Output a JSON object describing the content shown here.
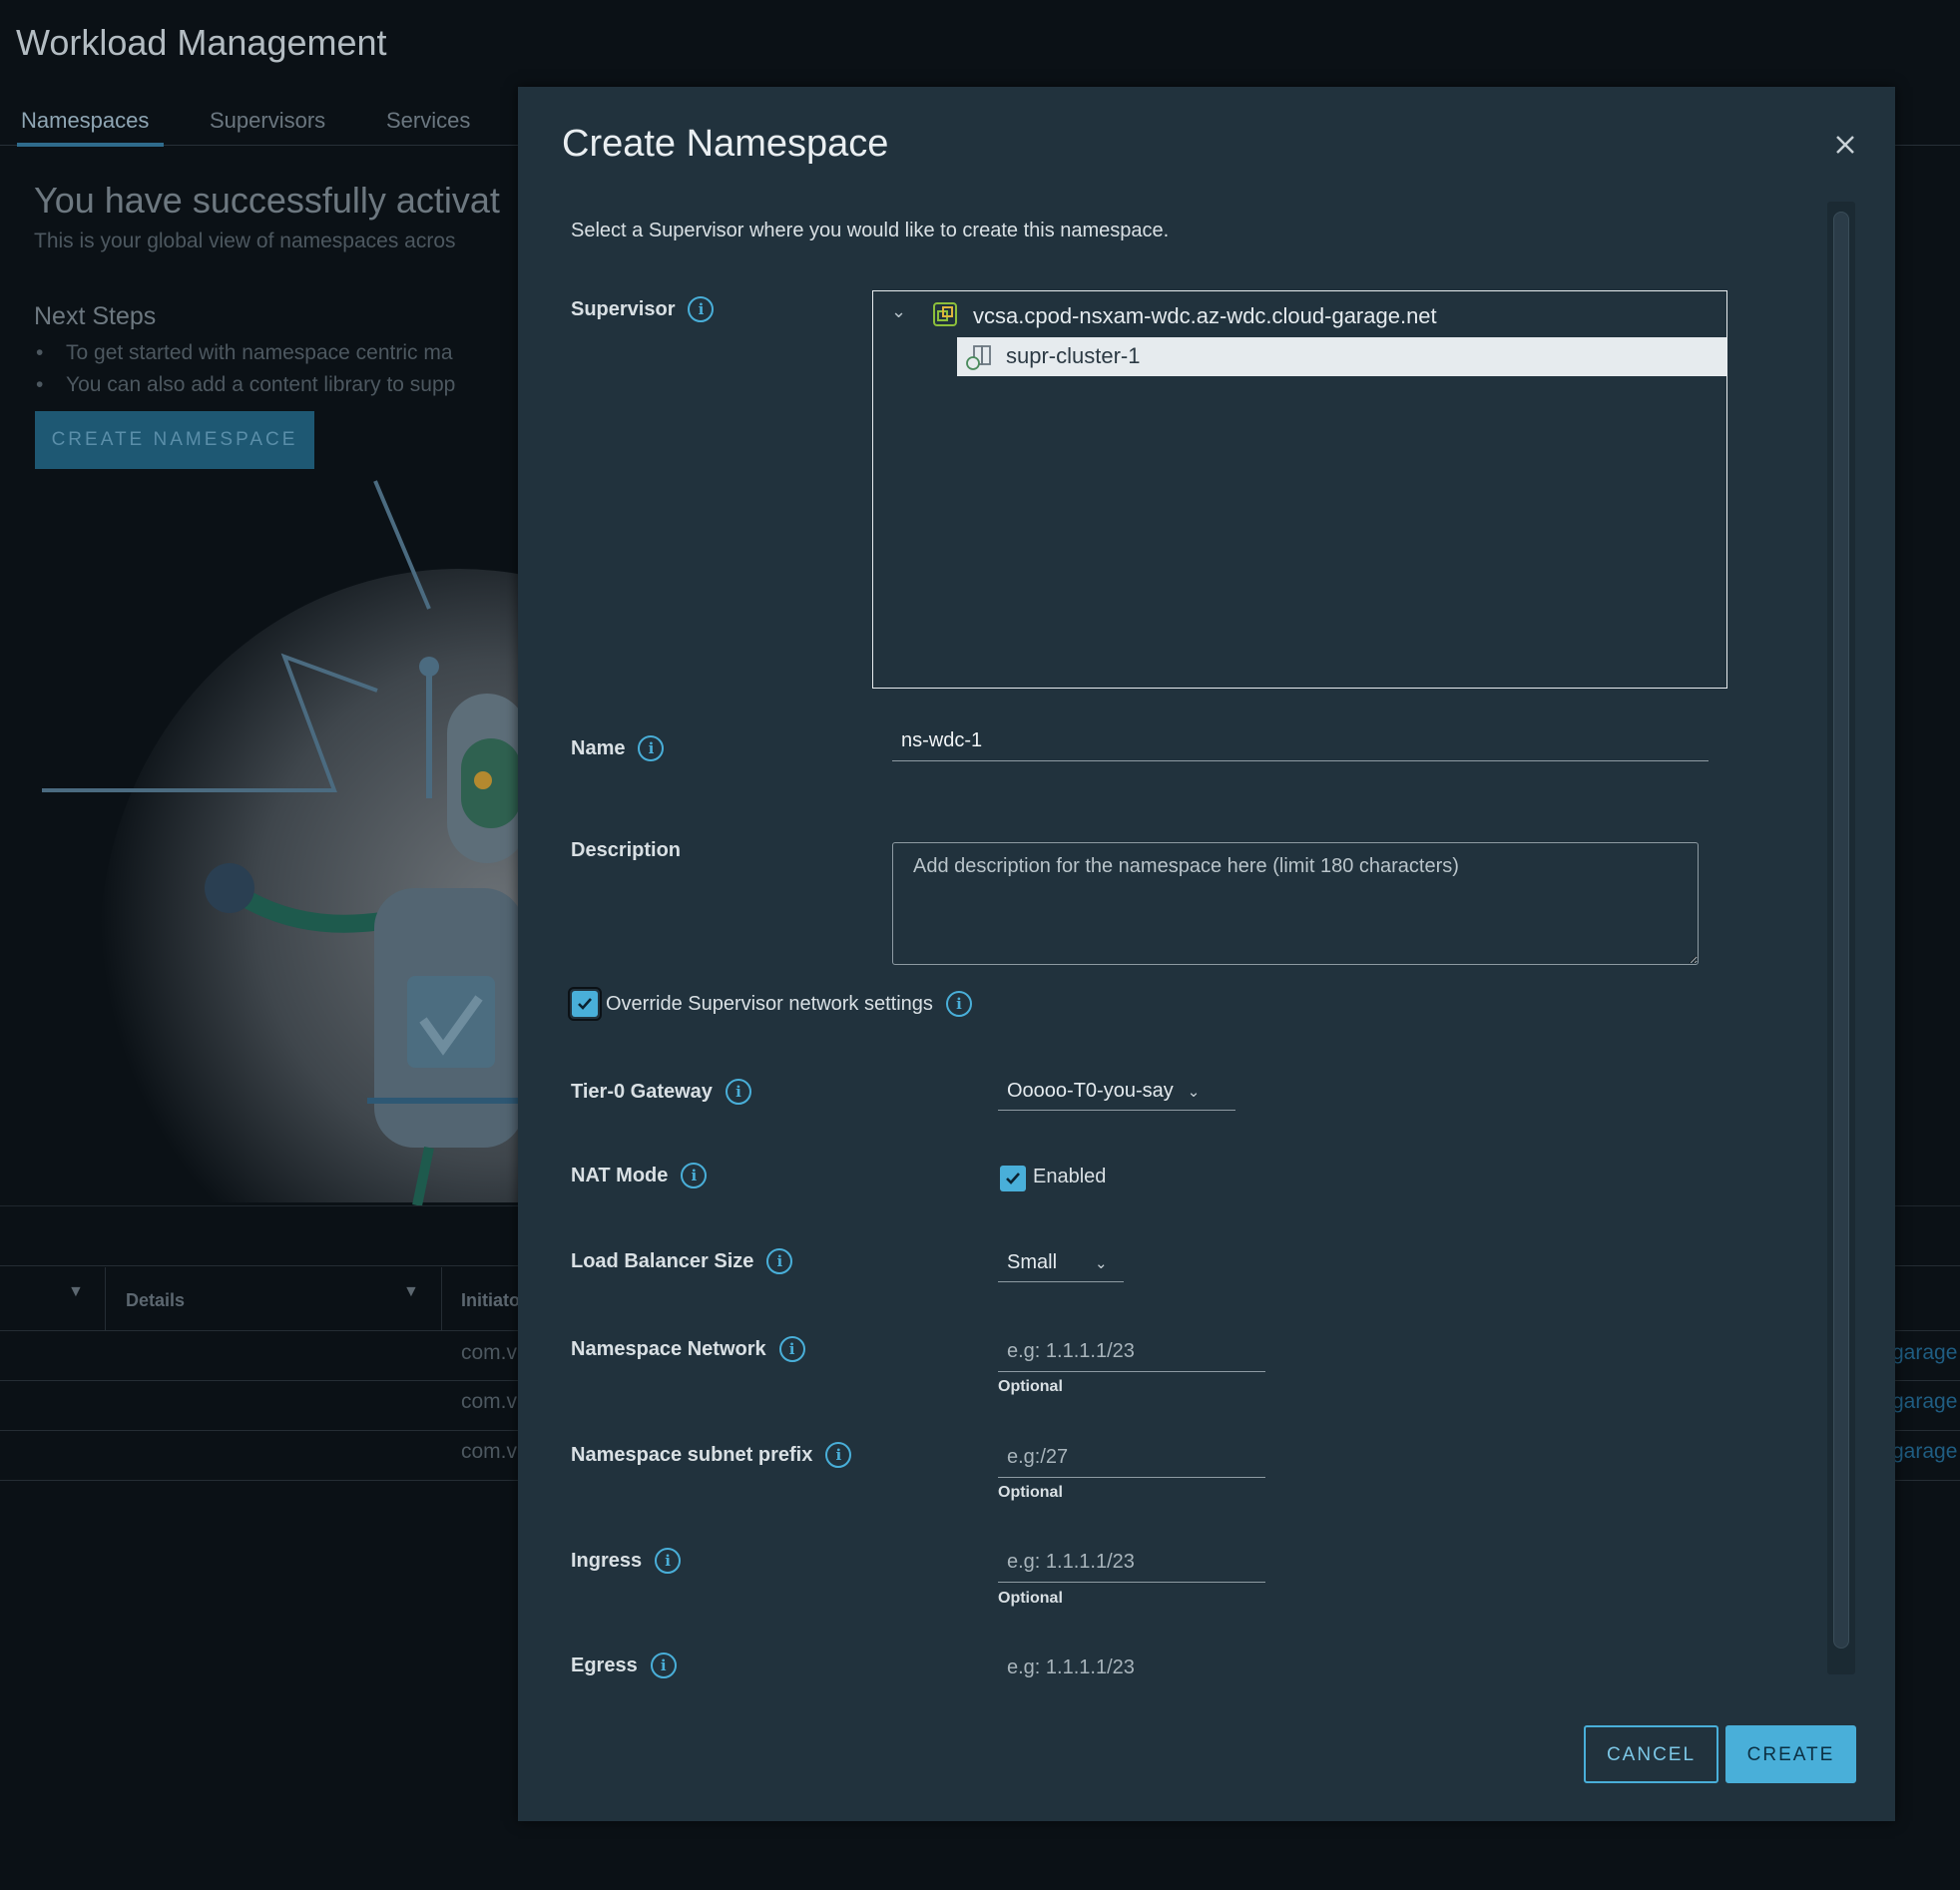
{
  "app": {
    "title": "Workload Management",
    "tabs": [
      "Namespaces",
      "Supervisors",
      "Services"
    ],
    "hero_title": "You have successfully activat",
    "hero_subtitle": "This is your global view of namespaces acros",
    "next_steps_title": "Next Steps",
    "next_steps": [
      "To get started with namespace centric ma",
      "You can also add a content library to supp"
    ],
    "create_namespace_button": "CREATE NAMESPACE",
    "grid": {
      "columns": [
        "Details",
        "Initiato"
      ],
      "rows": [
        {
          "initiator": "com.v",
          "link": "garage"
        },
        {
          "initiator": "com.v",
          "link": "garage"
        },
        {
          "initiator": "com.v",
          "link": "garage"
        }
      ]
    }
  },
  "modal": {
    "title": "Create Namespace",
    "intro": "Select a Supervisor where you would like to create this namespace.",
    "supervisor": {
      "label": "Supervisor",
      "vcenter": "vcsa.cpod-nsxam-wdc.az-wdc.cloud-garage.net",
      "cluster": "supr-cluster-1"
    },
    "name": {
      "label": "Name",
      "value": "ns-wdc-1"
    },
    "description": {
      "label": "Description",
      "placeholder": "Add description for the namespace here (limit 180 characters)"
    },
    "override": {
      "label": "Override Supervisor network settings",
      "checked": true
    },
    "tier0": {
      "label": "Tier-0 Gateway",
      "value": "Ooooo-T0-you-say"
    },
    "nat": {
      "label": "NAT Mode",
      "option": "Enabled",
      "checked": true
    },
    "lb_size": {
      "label": "Load Balancer Size",
      "value": "Small"
    },
    "ns_network": {
      "label": "Namespace Network",
      "placeholder": "e.g: 1.1.1.1/23",
      "hint": "Optional"
    },
    "ns_subnet": {
      "label": "Namespace subnet prefix",
      "placeholder": "e.g:/27",
      "hint": "Optional"
    },
    "ingress": {
      "label": "Ingress",
      "placeholder": "e.g: 1.1.1.1/23",
      "hint": "Optional"
    },
    "egress": {
      "label": "Egress",
      "placeholder": "e.g: 1.1.1.1/23"
    },
    "cancel_label": "CANCEL",
    "create_label": "CREATE"
  },
  "colors": {
    "accent": "#49afd9",
    "modal_bg": "#21323d",
    "page_bg": "#0b1116"
  },
  "icons": {
    "close": "close-icon",
    "info": "info-icon",
    "vcenter": "vcenter-icon",
    "cluster": "cluster-icon",
    "expand": "chevron-down-icon"
  }
}
